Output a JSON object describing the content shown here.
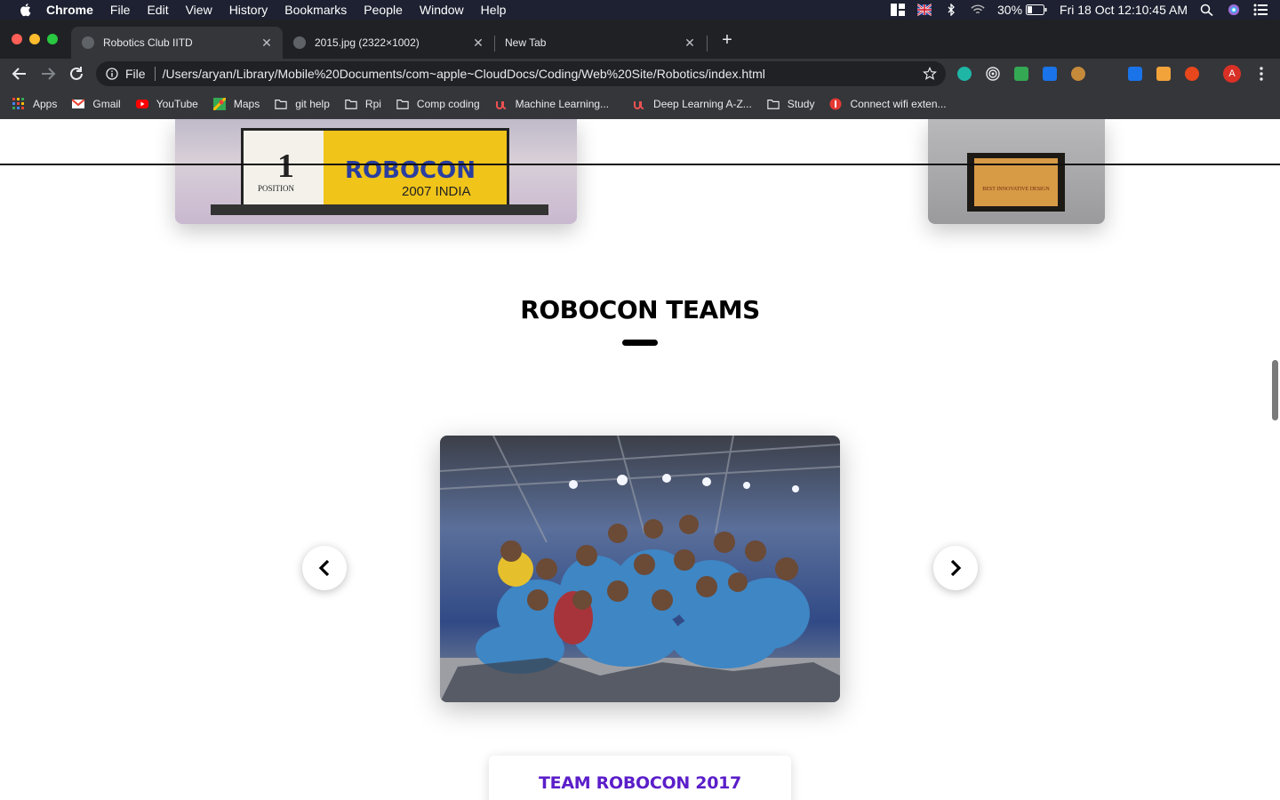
{
  "menubar": {
    "app_name": "Chrome",
    "items": [
      "File",
      "Edit",
      "View",
      "History",
      "Bookmarks",
      "People",
      "Window",
      "Help"
    ],
    "battery": "30%",
    "clock": "Fri 18 Oct  12:10:45 AM"
  },
  "tabs": [
    {
      "title": "Robotics Club IITD",
      "active": true
    },
    {
      "title": "2015.jpg (2322×1002)",
      "active": false
    },
    {
      "title": "New Tab",
      "active": false
    }
  ],
  "toolbar": {
    "scheme": "File",
    "url": "/Users/aryan/Library/Mobile%20Documents/com~apple~CloudDocs/Coding/Web%20Site/Robotics/index.html",
    "profile_initial": "A"
  },
  "bookmarks": [
    {
      "label": "Apps",
      "icon": "apps-grid-icon"
    },
    {
      "label": "Gmail",
      "icon": "gmail-icon"
    },
    {
      "label": "YouTube",
      "icon": "youtube-icon"
    },
    {
      "label": "Maps",
      "icon": "maps-icon"
    },
    {
      "label": "git help",
      "icon": "folder-icon"
    },
    {
      "label": "Rpi",
      "icon": "folder-icon"
    },
    {
      "label": "Comp coding",
      "icon": "folder-icon"
    },
    {
      "label": "Machine Learning...",
      "icon": "udemy-icon"
    },
    {
      "label": "Deep Learning A-Z...",
      "icon": "udemy-icon"
    },
    {
      "label": "Study",
      "icon": "folder-icon"
    },
    {
      "label": "Connect wifi exten...",
      "icon": "wifi-ext-icon"
    }
  ],
  "page": {
    "trophy_left_text_line1": "ROBOCON",
    "trophy_left_text_line2": "2007 INDIA",
    "trophy_left_position": "POSITION",
    "trophy_left_rank": "1",
    "trophy_right_text": "BEST INNOVATIVE DESIGN",
    "section_title": "ROBOCON TEAMS",
    "team_title": "TEAM ROBOCON 2017"
  },
  "colors": {
    "menubar": "#1d2131",
    "tabstrip": "#202124",
    "toolbar": "#35363a",
    "team_title": "#5b1ec9"
  }
}
